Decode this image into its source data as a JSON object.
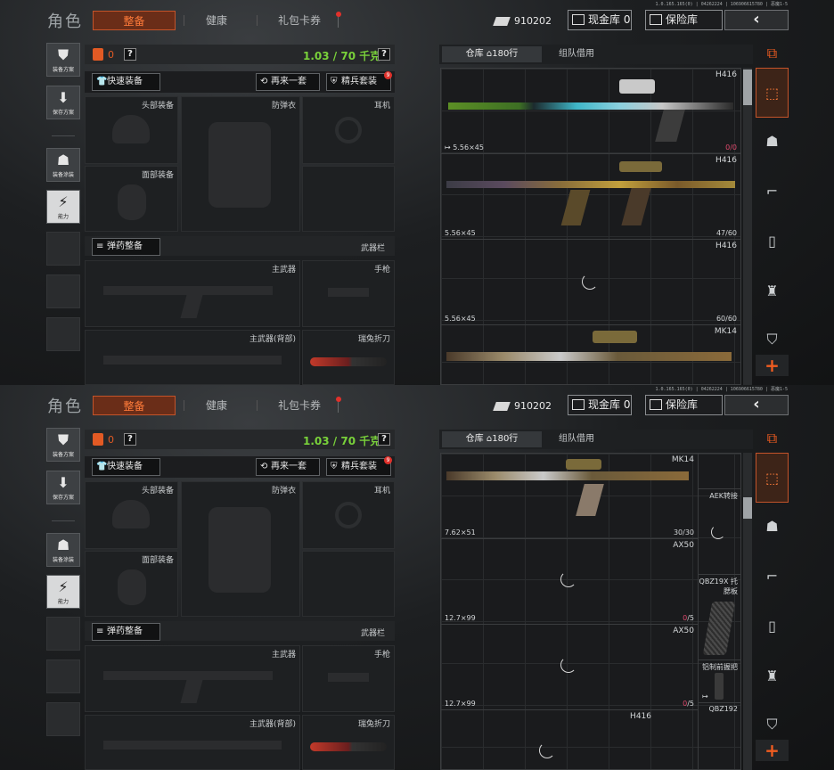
{
  "version": "1.0.165.165(0) | 04262224 | 106906615780 | 恶魔1-5",
  "header": {
    "title": "角色",
    "tabs": [
      "整备",
      "健康",
      "礼包卡券"
    ],
    "money": "910202",
    "cash_btn": "现金库 0",
    "safe_btn": "保险库",
    "back": "‹"
  },
  "side": {
    "loadout": "装备方案",
    "save": "保存方案",
    "paint": "装备涂装",
    "ability": "能力"
  },
  "equipment": {
    "bag_count": "0",
    "weight": "1.03 / 70 千克",
    "help": "?",
    "quick_btn": "快速装备",
    "again_btn": "再来一套",
    "elite_btn": "精兵套装",
    "elite_badge": "9",
    "head": "头部装备",
    "armor": "防弹衣",
    "ear": "耳机",
    "face": "面部装备",
    "ammo_btn": "弹药整备",
    "weapon_bar": "武器栏",
    "primary": "主武器",
    "pistol": "手枪",
    "primary_back": "主武器(背部)",
    "knife": "瑞兔折刀"
  },
  "warehouse": {
    "tab_warehouse": "仓库",
    "rows": "180行",
    "tab_team": "组队借用"
  },
  "frame1_items": [
    {
      "name": "H416",
      "caliber": "5.56×45",
      "count_red": "0/0",
      "count": ""
    },
    {
      "name": "H416",
      "caliber": "5.56×45",
      "count_red": "",
      "count": "47/60"
    },
    {
      "name": "H416",
      "caliber": "5.56×45",
      "count_red": "",
      "count": "60/60"
    },
    {
      "name": "MK14",
      "caliber": "",
      "count_red": "",
      "count": ""
    }
  ],
  "frame2_items": [
    {
      "name": "MK14",
      "caliber": "7.62×51",
      "count_red": "",
      "count": "30/30"
    },
    {
      "name": "AX50",
      "caliber": "12.7×99",
      "count_red": "0",
      "count": "/5"
    },
    {
      "name": "AX50",
      "caliber": "12.7×99",
      "count_red": "0",
      "count": "/5"
    },
    {
      "name": "H416",
      "caliber": "",
      "count_red": "",
      "count": ""
    }
  ],
  "frame2_side_items": [
    "AEK转接",
    "QBZ19X 托腮板",
    "铝制前握把",
    "QBZ192"
  ],
  "colors": {
    "accent": "#c4542a",
    "weight_green": "#79d13a",
    "warn_red": "#e04a6d"
  }
}
